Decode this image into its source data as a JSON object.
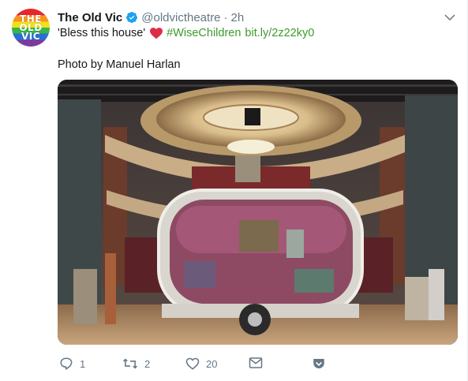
{
  "avatar": {
    "lines": [
      "THE",
      "OLD",
      "VIC"
    ]
  },
  "header": {
    "name": "The Old Vic",
    "handle": "@oldvictheatre",
    "separator": "·",
    "time": "2h"
  },
  "tweet": {
    "quote": "'Bless this house'",
    "hashtag": "#WiseChildren",
    "link": "bit.ly/2z22ky0",
    "credit": "Photo by Manuel Harlan"
  },
  "actions": {
    "reply_count": "1",
    "retweet_count": "2",
    "like_count": "20"
  },
  "colors": {
    "link": "#3d9a2c",
    "muted": "#657786",
    "verified": "#1da1f2",
    "heart": "#e0245e"
  }
}
